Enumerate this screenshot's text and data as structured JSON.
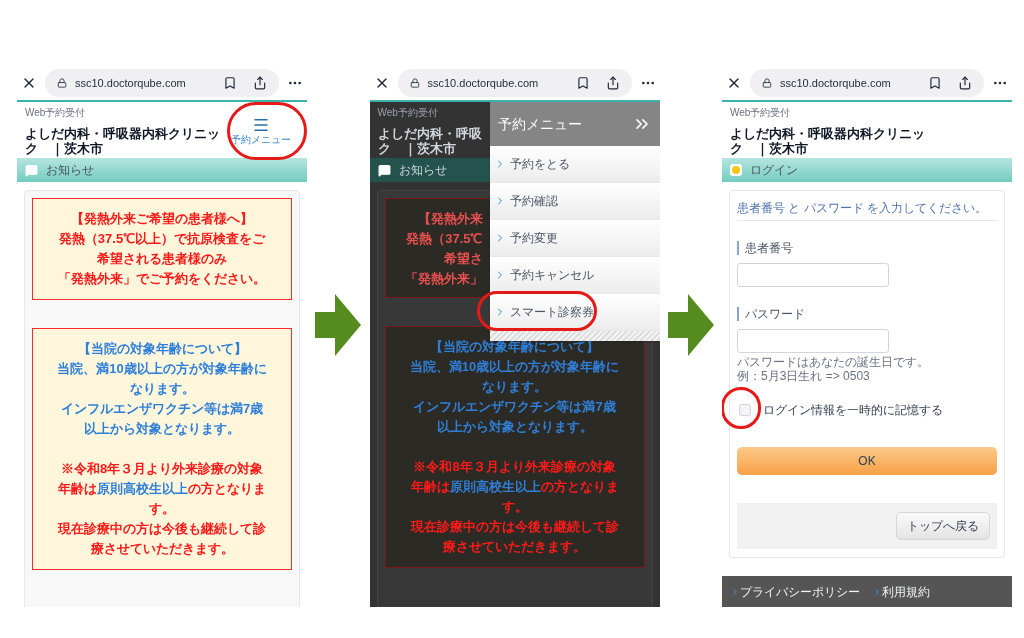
{
  "panels": [
    {
      "kind": "notices",
      "browser": {
        "url": "ssc10.doctorqube.com"
      },
      "header": {
        "service_label": "Web予約受付",
        "clinic_lines": [
          "よしだ内科・呼吸器内科クリニッ",
          "ク　｜茨木市"
        ],
        "menu_button": {
          "label": "予約メニュー",
          "circled": true
        }
      },
      "section_title": "お知らせ",
      "notices": [
        {
          "lines": [
            {
              "segments": [
                {
                  "text": "【発熱外来ご希望の患者様へ】",
                  "color": "#ff1a1a"
                }
              ]
            },
            {
              "segments": [
                {
                  "text": "発熱（37.5℃以上）で抗原検査をご",
                  "color": "#ff1a1a"
                }
              ]
            },
            {
              "segments": [
                {
                  "text": "希望される患者様のみ",
                  "color": "#ff1a1a"
                }
              ]
            },
            {
              "segments": [
                {
                  "text": "「発熱外来」でご予約をください。",
                  "color": "#ff1a1a"
                }
              ]
            }
          ]
        },
        {
          "lines": [
            {
              "segments": [
                {
                  "text": "【当院の対象年齢について】",
                  "color": "#2f7fd8"
                }
              ]
            },
            {
              "segments": [
                {
                  "text": "当院、満10歳以上の方が対象年齢に",
                  "color": "#2f7fd8"
                }
              ]
            },
            {
              "segments": [
                {
                  "text": "なります。",
                  "color": "#2f7fd8"
                }
              ]
            },
            {
              "segments": [
                {
                  "text": "インフルエンザワクチン等は満7歳",
                  "color": "#2f7fd8"
                }
              ]
            },
            {
              "segments": [
                {
                  "text": "以上から対象となります。",
                  "color": "#2f7fd8"
                }
              ]
            },
            {
              "gap_before": true,
              "segments": [
                {
                  "text": "※令和8年３月より外来診療の対象",
                  "color": "#ff1a1a"
                }
              ]
            },
            {
              "segments": [
                {
                  "text": "年齢は",
                  "color": "#ff1a1a"
                },
                {
                  "text": "原則高校生以上",
                  "color": "#2f7fd8"
                },
                {
                  "text": "の方となりま",
                  "color": "#ff1a1a"
                }
              ]
            },
            {
              "segments": [
                {
                  "text": "す。",
                  "color": "#ff1a1a"
                }
              ]
            },
            {
              "segments": [
                {
                  "text": "現在診療中の方は今後も継続して診",
                  "color": "#ff1a1a"
                }
              ]
            },
            {
              "segments": [
                {
                  "text": "療させていただきます。",
                  "color": "#ff1a1a"
                }
              ]
            }
          ]
        }
      ]
    },
    {
      "kind": "menu_open",
      "browser": {
        "url": "ssc10.doctorqube.com"
      },
      "header": {
        "service_label": "Web予約受付",
        "clinic_lines": [
          "よしだ内科・呼吸",
          "ク　｜茨木市"
        ]
      },
      "section_title": "お知らせ",
      "partial_notice": {
        "lines": [
          "【発熱外来",
          "発熱（37.5℃",
          "希望さ",
          "「発熱外来」"
        ]
      },
      "notices": [
        {
          "lines": [
            {
              "segments": [
                {
                  "text": "【当院の対象年齢について】",
                  "color": "#2f7fd8"
                }
              ]
            },
            {
              "segments": [
                {
                  "text": "当院、満10歳以上の方が対象年齢に",
                  "color": "#2f7fd8"
                }
              ]
            },
            {
              "segments": [
                {
                  "text": "なります。",
                  "color": "#2f7fd8"
                }
              ]
            },
            {
              "segments": [
                {
                  "text": "インフルエンザワクチン等は満7歳",
                  "color": "#2f7fd8"
                }
              ]
            },
            {
              "segments": [
                {
                  "text": "以上から対象となります。",
                  "color": "#2f7fd8"
                }
              ]
            },
            {
              "gap_before": true,
              "segments": [
                {
                  "text": "※令和8年３月より外来診療の対象",
                  "color": "#ff1a1a"
                }
              ]
            },
            {
              "segments": [
                {
                  "text": "年齢は",
                  "color": "#ff1a1a"
                },
                {
                  "text": "原則高校生以上",
                  "color": "#2f7fd8"
                },
                {
                  "text": "の方となりま",
                  "color": "#ff1a1a"
                }
              ]
            },
            {
              "segments": [
                {
                  "text": "す。",
                  "color": "#ff1a1a"
                }
              ]
            },
            {
              "segments": [
                {
                  "text": "現在診療中の方は今後も継続して診",
                  "color": "#ff1a1a"
                }
              ]
            },
            {
              "segments": [
                {
                  "text": "療させていただきます。",
                  "color": "#ff1a1a"
                }
              ]
            }
          ]
        }
      ],
      "menu": {
        "title": "予約メニュー",
        "items": [
          {
            "label": "予約をとる",
            "circled": false
          },
          {
            "label": "予約確認",
            "circled": false
          },
          {
            "label": "予約変更",
            "circled": false
          },
          {
            "label": "予約キャンセル",
            "circled": false
          },
          {
            "label": "スマート診察券",
            "circled": true
          }
        ]
      }
    },
    {
      "kind": "login",
      "browser": {
        "url": "ssc10.doctorqube.com"
      },
      "header": {
        "service_label": "Web予約受付",
        "clinic_lines": [
          "よしだ内科・呼吸器内科クリニッ",
          "ク　｜茨木市"
        ]
      },
      "section_title": "ログイン",
      "instruction": "患者番号 と パスワード を入力してください。",
      "fields": [
        {
          "label": "患者番号"
        },
        {
          "label": "パスワード"
        }
      ],
      "hint_lines": [
        "パスワードはあなたの誕生日です。",
        "例：5月3日生れ => 0503"
      ],
      "remember": {
        "label": "ログイン情報を一時的に記憶する",
        "checked": false,
        "circled": true
      },
      "ok_button": "OK",
      "back_button": "トップへ戻る",
      "footer_links": [
        "プライバシーポリシー",
        "利用規約"
      ]
    }
  ]
}
